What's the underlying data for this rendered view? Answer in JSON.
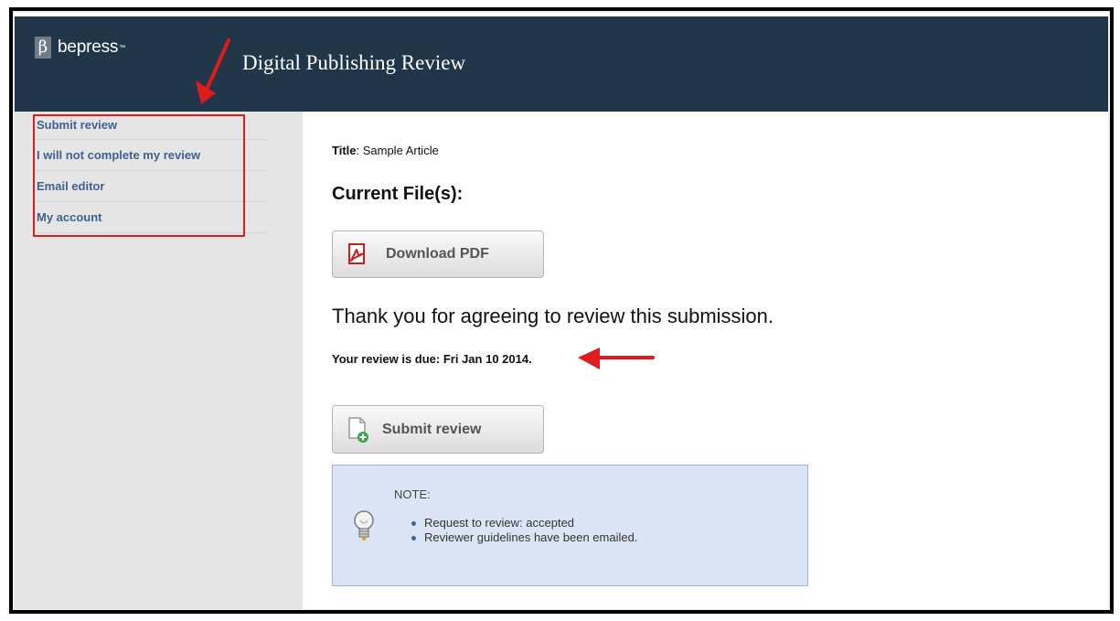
{
  "header": {
    "logo_text": "bepress",
    "logo_tm": "™",
    "logo_mark": "β",
    "site_title": "Digital Publishing Review"
  },
  "sidebar": {
    "items": [
      {
        "label": "Submit review"
      },
      {
        "label": "I will not complete my review"
      },
      {
        "label": "Email editor"
      },
      {
        "label": "My account"
      }
    ]
  },
  "main": {
    "title_label": "Title",
    "title_value": ": Sample Article",
    "files_heading": "Current File(s):",
    "download_button": "Download PDF",
    "thank_you": "Thank you for agreeing to review this submission.",
    "due_text": "Your review is due: Fri Jan 10 2014.",
    "submit_button": "Submit review",
    "note": {
      "label": "NOTE:",
      "items": [
        "Request to review: accepted",
        "Reviewer guidelines have been emailed."
      ]
    }
  },
  "icons": {
    "pdf": "pdf-icon",
    "submit": "document-add-icon",
    "note": "lightbulb-icon",
    "annotation": "red-arrow-icon"
  },
  "colors": {
    "header_bg": "#22364a",
    "nav_link": "#3f6290",
    "annotation_red": "#e01b1b",
    "note_bg": "#dbe5f5"
  }
}
